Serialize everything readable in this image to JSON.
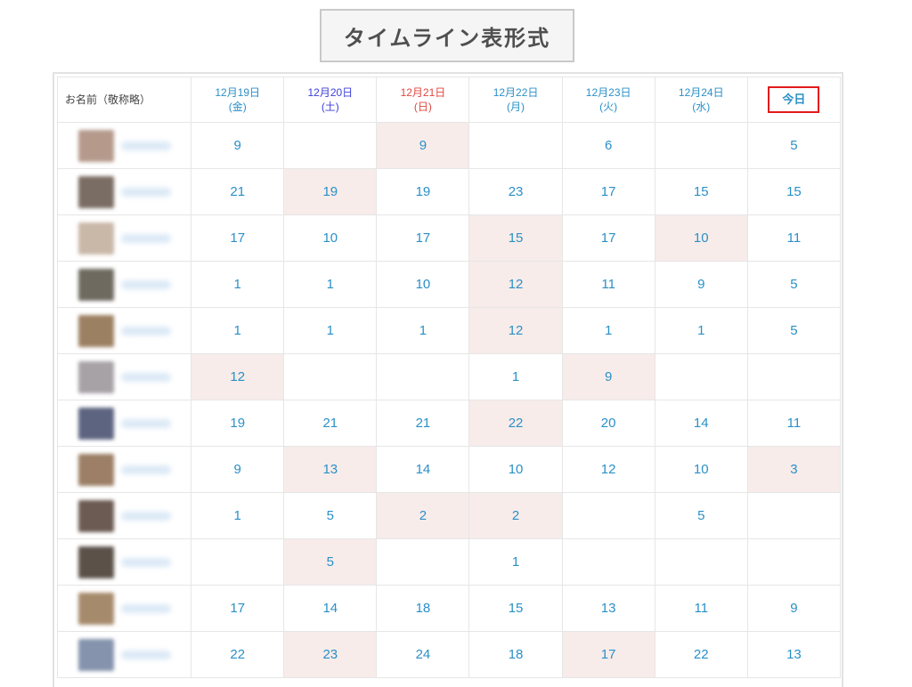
{
  "title": "タイムライン表形式",
  "table": {
    "name_header": "お名前（敬称略）",
    "days": [
      {
        "date": "12月19日",
        "weekday": "(金)",
        "kind": "weekday"
      },
      {
        "date": "12月20日",
        "weekday": "(土)",
        "kind": "sat"
      },
      {
        "date": "12月21日",
        "weekday": "(日)",
        "kind": "sun"
      },
      {
        "date": "12月22日",
        "weekday": "(月)",
        "kind": "weekday"
      },
      {
        "date": "12月23日",
        "weekday": "(火)",
        "kind": "weekday"
      },
      {
        "date": "12月24日",
        "weekday": "(水)",
        "kind": "weekday"
      }
    ],
    "today_label": "今日",
    "rows": [
      {
        "avatar_color": "#b59a8c",
        "cells": [
          "9",
          "",
          "9",
          "",
          "6",
          "",
          "5"
        ],
        "highlighted": [
          false,
          false,
          true,
          false,
          false,
          false,
          false
        ]
      },
      {
        "avatar_color": "#7a6d63",
        "cells": [
          "21",
          "19",
          "19",
          "23",
          "17",
          "15",
          "15"
        ],
        "highlighted": [
          false,
          true,
          false,
          false,
          false,
          false,
          false
        ]
      },
      {
        "avatar_color": "#c9b7a8",
        "cells": [
          "17",
          "10",
          "17",
          "15",
          "17",
          "10",
          "11"
        ],
        "highlighted": [
          false,
          false,
          false,
          true,
          false,
          true,
          false
        ]
      },
      {
        "avatar_color": "#6f6a60",
        "cells": [
          "1",
          "1",
          "10",
          "12",
          "11",
          "9",
          "5"
        ],
        "highlighted": [
          false,
          false,
          false,
          true,
          false,
          false,
          false
        ]
      },
      {
        "avatar_color": "#9c8062",
        "cells": [
          "1",
          "1",
          "1",
          "12",
          "1",
          "1",
          "5"
        ],
        "highlighted": [
          false,
          false,
          false,
          true,
          false,
          false,
          false
        ]
      },
      {
        "avatar_color": "#a6a2a6",
        "cells": [
          "12",
          "",
          "",
          "1",
          "9",
          "",
          ""
        ],
        "highlighted": [
          true,
          false,
          false,
          false,
          true,
          false,
          false
        ]
      },
      {
        "avatar_color": "#5d6480",
        "cells": [
          "19",
          "21",
          "21",
          "22",
          "20",
          "14",
          "11"
        ],
        "highlighted": [
          false,
          false,
          false,
          true,
          false,
          false,
          false
        ]
      },
      {
        "avatar_color": "#9c7f66",
        "cells": [
          "9",
          "13",
          "14",
          "10",
          "12",
          "10",
          "3"
        ],
        "highlighted": [
          false,
          true,
          false,
          false,
          false,
          false,
          true
        ]
      },
      {
        "avatar_color": "#6b5b52",
        "cells": [
          "1",
          "5",
          "2",
          "2",
          "",
          "5",
          ""
        ],
        "highlighted": [
          false,
          false,
          true,
          true,
          false,
          false,
          false
        ]
      },
      {
        "avatar_color": "#5b5149",
        "cells": [
          "",
          "5",
          "",
          "1",
          "",
          "",
          ""
        ],
        "highlighted": [
          false,
          true,
          false,
          false,
          false,
          false,
          false
        ]
      },
      {
        "avatar_color": "#a68a6c",
        "cells": [
          "17",
          "14",
          "18",
          "15",
          "13",
          "11",
          "9"
        ],
        "highlighted": [
          false,
          false,
          false,
          false,
          false,
          false,
          false
        ]
      },
      {
        "avatar_color": "#8593ad",
        "cells": [
          "22",
          "23",
          "24",
          "18",
          "17",
          "22",
          "13"
        ],
        "highlighted": [
          false,
          true,
          false,
          false,
          true,
          false,
          false
        ]
      }
    ]
  },
  "colors": {
    "accent_blue": "#2a90c8",
    "saturday": "#3b3fd9",
    "sunday": "#e0473f",
    "highlight_bg": "#f7ecea",
    "today_border": "#e21b1b"
  }
}
